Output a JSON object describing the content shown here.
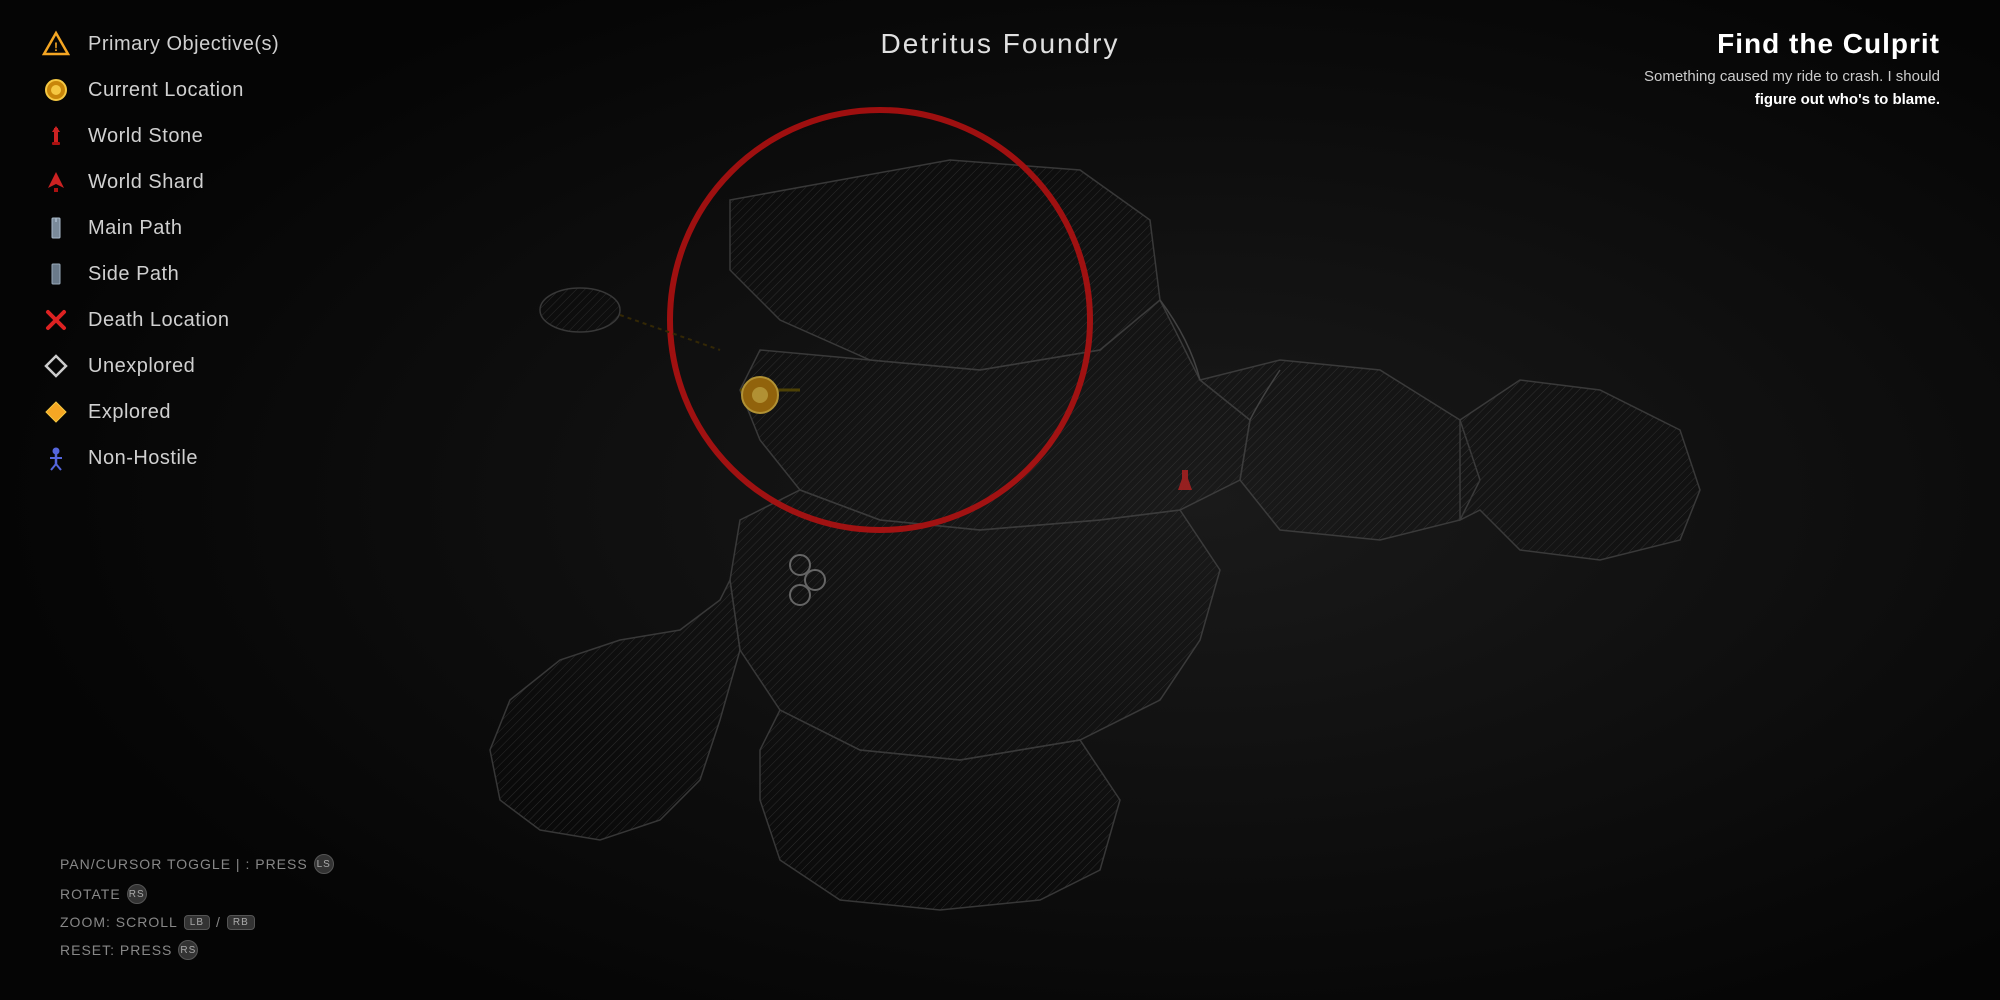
{
  "header": {
    "map_name": "Detritus Foundry"
  },
  "objective": {
    "title": "Find the Culprit",
    "description": "Something caused my ride to crash. I should",
    "description_bold": "figure out who's to blame."
  },
  "legend": {
    "items": [
      {
        "id": "primary-objective",
        "label": "Primary Objective(s)",
        "icon": "warning-triangle",
        "color": "#f5a623"
      },
      {
        "id": "current-location",
        "label": "Current Location",
        "icon": "location-circle",
        "color": "#f5a623"
      },
      {
        "id": "world-stone",
        "label": "World Stone",
        "icon": "world-stone",
        "color": "#cc2222"
      },
      {
        "id": "world-shard",
        "label": "World Shard",
        "icon": "world-shard",
        "color": "#cc2222"
      },
      {
        "id": "main-path",
        "label": "Main Path",
        "icon": "main-path",
        "color": "#8899aa"
      },
      {
        "id": "side-path",
        "label": "Side Path",
        "icon": "side-path",
        "color": "#8899aa"
      },
      {
        "id": "death-location",
        "label": "Death Location",
        "icon": "death-x",
        "color": "#dd2222"
      },
      {
        "id": "unexplored",
        "label": "Unexplored",
        "icon": "diamond-outline",
        "color": "#ffffff"
      },
      {
        "id": "explored",
        "label": "Explored",
        "icon": "diamond-filled",
        "color": "#f5a623"
      },
      {
        "id": "non-hostile",
        "label": "Non-Hostile",
        "icon": "figure",
        "color": "#5566dd"
      }
    ]
  },
  "controls": [
    {
      "id": "pan-cursor",
      "text": "PAN/CURSOR TOGGLE | : PRESS",
      "badge": "LS",
      "badge_type": "circle"
    },
    {
      "id": "rotate",
      "text": "ROTATE",
      "badge": "RS",
      "badge_type": "circle"
    },
    {
      "id": "zoom",
      "text": "ZOOM: SCROLL",
      "badge1": "LB",
      "badge2": "RB",
      "badge_type": "rect",
      "separator": "/"
    },
    {
      "id": "reset",
      "text": "RESET: PRESS",
      "badge": "RS",
      "badge_type": "circle"
    }
  ]
}
